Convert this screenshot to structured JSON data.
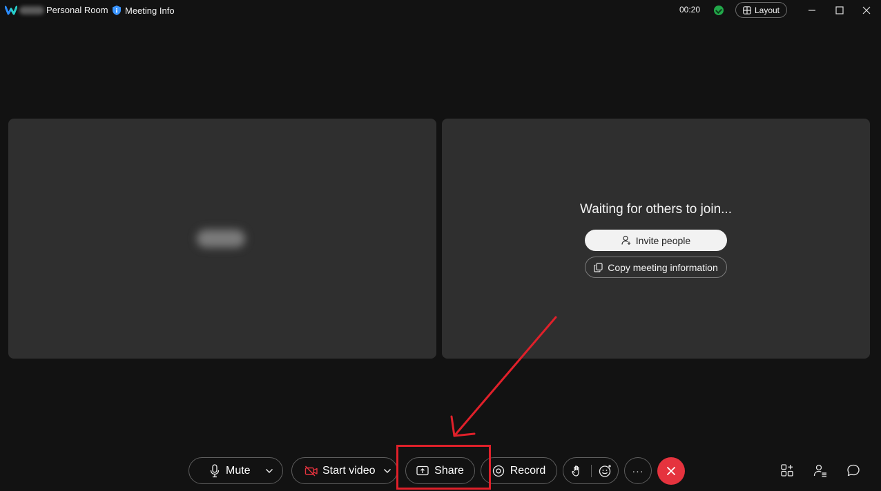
{
  "titlebar": {
    "room_label": "Personal Room",
    "meeting_info_label": "Meeting Info",
    "elapsed_time": "00:20",
    "layout_label": "Layout"
  },
  "stage": {
    "waiting_text": "Waiting for others to join...",
    "invite_label": "Invite people",
    "copy_label": "Copy meeting information"
  },
  "toolbar": {
    "mute_label": "Mute",
    "start_video_label": "Start video",
    "share_label": "Share",
    "record_label": "Record",
    "more_label": "···"
  },
  "colors": {
    "background": "#121212",
    "tile": "#2f2f2f",
    "end_call": "#e5333e",
    "connection_ok": "#22a84a",
    "annotation": "#e0202a",
    "video_off": "#e5333e"
  },
  "icons": {
    "app_logo": "webex-logo",
    "meeting_info": "shield-icon",
    "layout": "layout-grid-icon",
    "mute": "microphone-icon",
    "video": "camera-off-icon",
    "share": "share-screen-icon",
    "record": "record-icon",
    "raise_hand": "hand-icon",
    "reactions": "emoji-icon",
    "end_call": "close-icon",
    "apps": "apps-icon",
    "participants": "participants-icon",
    "chat": "chat-icon"
  }
}
